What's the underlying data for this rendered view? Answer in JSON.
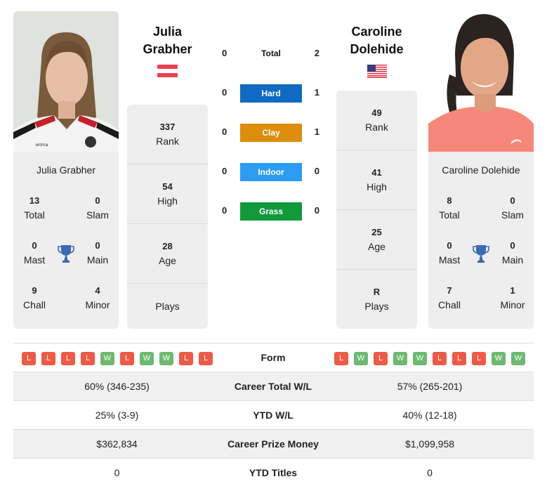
{
  "colors": {
    "hard": "#0e6ac3",
    "clay": "#dd8e0b",
    "indoor": "#2b9bf4",
    "grass": "#119a3a",
    "win": "#6cba6f",
    "loss": "#ee5a45",
    "trophy": "#3b6ab6",
    "panel": "#eeeeee"
  },
  "player1": {
    "name_line1": "Julia",
    "name_line2": "Grabher",
    "full_name": "Julia Grabher",
    "country_flag": "austria-flag",
    "titles": {
      "total": "13",
      "total_label": "Total",
      "slam": "0",
      "slam_label": "Slam",
      "mast": "0",
      "mast_label": "Mast",
      "main": "0",
      "main_label": "Main",
      "chall": "9",
      "chall_label": "Chall",
      "minor": "4",
      "minor_label": "Minor"
    },
    "rank": "337",
    "rank_label": "Rank",
    "high": "54",
    "high_label": "High",
    "age": "28",
    "age_label": "Age",
    "plays": "",
    "plays_label": "Plays",
    "form": [
      "L",
      "L",
      "L",
      "L",
      "W",
      "L",
      "W",
      "W",
      "L",
      "L"
    ]
  },
  "player2": {
    "name_line1": "Caroline",
    "name_line2": "Dolehide",
    "full_name": "Caroline Dolehide",
    "country_flag": "usa-flag",
    "titles": {
      "total": "8",
      "total_label": "Total",
      "slam": "0",
      "slam_label": "Slam",
      "mast": "0",
      "mast_label": "Mast",
      "main": "0",
      "main_label": "Main",
      "chall": "7",
      "chall_label": "Chall",
      "minor": "1",
      "minor_label": "Minor"
    },
    "rank": "49",
    "rank_label": "Rank",
    "high": "41",
    "high_label": "High",
    "age": "25",
    "age_label": "Age",
    "plays": "R",
    "plays_label": "Plays",
    "form": [
      "L",
      "W",
      "L",
      "W",
      "W",
      "L",
      "L",
      "L",
      "W",
      "W"
    ]
  },
  "h2h": [
    {
      "label": "Total",
      "p1": "0",
      "p2": "2"
    },
    {
      "label": "Hard",
      "p1": "0",
      "p2": "1"
    },
    {
      "label": "Clay",
      "p1": "0",
      "p2": "1"
    },
    {
      "label": "Indoor",
      "p1": "0",
      "p2": "0"
    },
    {
      "label": "Grass",
      "p1": "0",
      "p2": "0"
    }
  ],
  "table": {
    "form_label": "Form",
    "rows": [
      {
        "p1": "60% (346-235)",
        "label": "Career Total W/L",
        "p2": "57% (265-201)"
      },
      {
        "p1": "25% (3-9)",
        "label": "YTD W/L",
        "p2": "40% (12-18)"
      },
      {
        "p1": "$362,834",
        "label": "Career Prize Money",
        "p2": "$1,099,958"
      },
      {
        "p1": "0",
        "label": "YTD Titles",
        "p2": "0"
      }
    ]
  }
}
